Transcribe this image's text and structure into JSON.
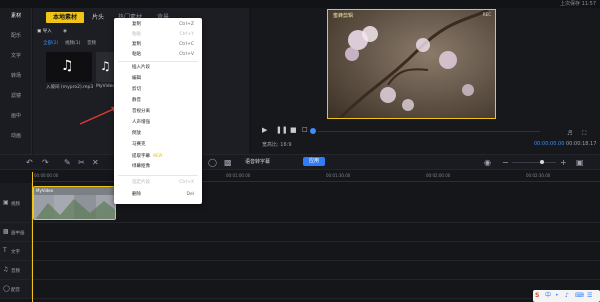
{
  "status": {
    "clock": "上次保存 11:57"
  },
  "sidebar": {
    "items": [
      {
        "label": "素材"
      },
      {
        "label": "配乐"
      },
      {
        "label": "文字"
      },
      {
        "label": "转场"
      },
      {
        "label": "滤镜"
      },
      {
        "label": "画中"
      },
      {
        "label": "动画"
      }
    ]
  },
  "material": {
    "tabs": [
      {
        "label": "本地素材"
      },
      {
        "label": "片头"
      },
      {
        "label": "热门素材"
      },
      {
        "label": "背景"
      }
    ],
    "filters": {
      "import": "导入",
      "all": "全部(2)",
      "video": "视频(1)",
      "audio": "音频"
    },
    "items": [
      {
        "label": "入坡间 (mypro2).mp3"
      },
      {
        "label": "MyVideo..."
      }
    ]
  },
  "context_menu": {
    "items": [
      {
        "label": "复制",
        "key": "Ctrl+Z",
        "disabled": false
      },
      {
        "label": "粘贴",
        "key": "Ctrl+Y",
        "disabled": true
      },
      {
        "label": "复制",
        "key": "Ctrl+C",
        "disabled": false
      },
      {
        "label": "粘贴",
        "key": "Ctrl+V",
        "disabled": false
      },
      {
        "label": "插入片段",
        "key": "",
        "disabled": false
      },
      {
        "label": "编辑",
        "key": "",
        "disabled": false
      },
      {
        "label": "剪切",
        "key": "",
        "disabled": false
      },
      {
        "label": "静音",
        "key": "",
        "disabled": false
      },
      {
        "label": "音视分离",
        "key": "",
        "disabled": false
      },
      {
        "label": "人声增强",
        "key": "",
        "disabled": false
      },
      {
        "label": "倒放",
        "key": "",
        "disabled": false
      },
      {
        "label": "马赛克",
        "key": "",
        "disabled": false
      },
      {
        "label": "提取字幕",
        "key": "",
        "badge": "NEW",
        "disabled": false
      },
      {
        "label": "绿幕抠像",
        "key": "",
        "disabled": false
      },
      {
        "label": "选定片段",
        "key": "Ctrl+X",
        "disabled": true
      },
      {
        "label": "删除",
        "key": "Del",
        "disabled": false
      }
    ]
  },
  "preview": {
    "title": "蜜蜂剪辑",
    "ratio_label": "宽高比: 16:9",
    "time_current": "00:00:00.00",
    "time_total": "00:00:18.17"
  },
  "timeline": {
    "subtitle_button": "语音转字幕",
    "apply_button": "应用",
    "ruler": [
      "00:00:00.00",
      "00:00:30.00",
      "00:01:00.00",
      "00:01:30.00",
      "00:02:00.00",
      "00:02:30.00"
    ],
    "tracks": [
      {
        "name": "视频"
      },
      {
        "name": "画中画"
      },
      {
        "name": "文字"
      },
      {
        "name": "音频"
      },
      {
        "name": "配音"
      }
    ],
    "clip_label": "MyVideo"
  },
  "tray": {
    "icons": [
      "S",
      "中",
      "•",
      "♪",
      "⌨",
      "☰"
    ]
  },
  "colors": {
    "accent": "#f0c419",
    "blue": "#2f7cf6",
    "arrow": "#e03b2e"
  }
}
